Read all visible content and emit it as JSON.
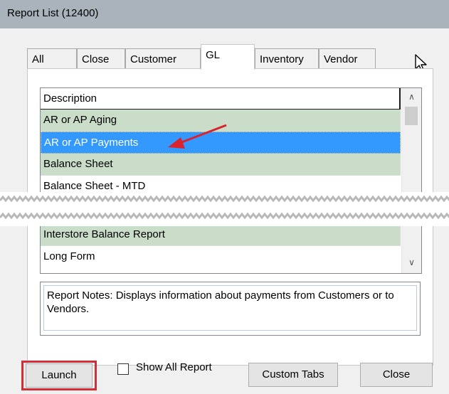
{
  "window": {
    "title": "Report List (12400)"
  },
  "tabs": [
    {
      "label": "All",
      "active": false
    },
    {
      "label": "Close",
      "active": false
    },
    {
      "label": "Customer",
      "active": false
    },
    {
      "label": "GL",
      "active": true
    },
    {
      "label": "Inventory",
      "active": false
    },
    {
      "label": "Vendor",
      "active": false
    }
  ],
  "list": {
    "header": "Description",
    "rows_top": [
      "AR or AP Aging",
      "AR or AP Payments",
      "Balance Sheet",
      "Balance Sheet - MTD"
    ],
    "rows_bottom": [
      "Interstore Balance Report",
      "Long Form"
    ],
    "selected": "AR or AP Payments"
  },
  "notes": {
    "text": "Report Notes:  Displays information about payments from Customers or to Vendors."
  },
  "buttons": {
    "launch": "Launch",
    "show_all": "Show All Report",
    "custom_tabs": "Custom Tabs",
    "close": "Close"
  },
  "colors": {
    "row_green": "#c9ddc9",
    "selection": "#3399ff",
    "highlight_box": "#d42d3a",
    "arrow": "#d9232e"
  }
}
